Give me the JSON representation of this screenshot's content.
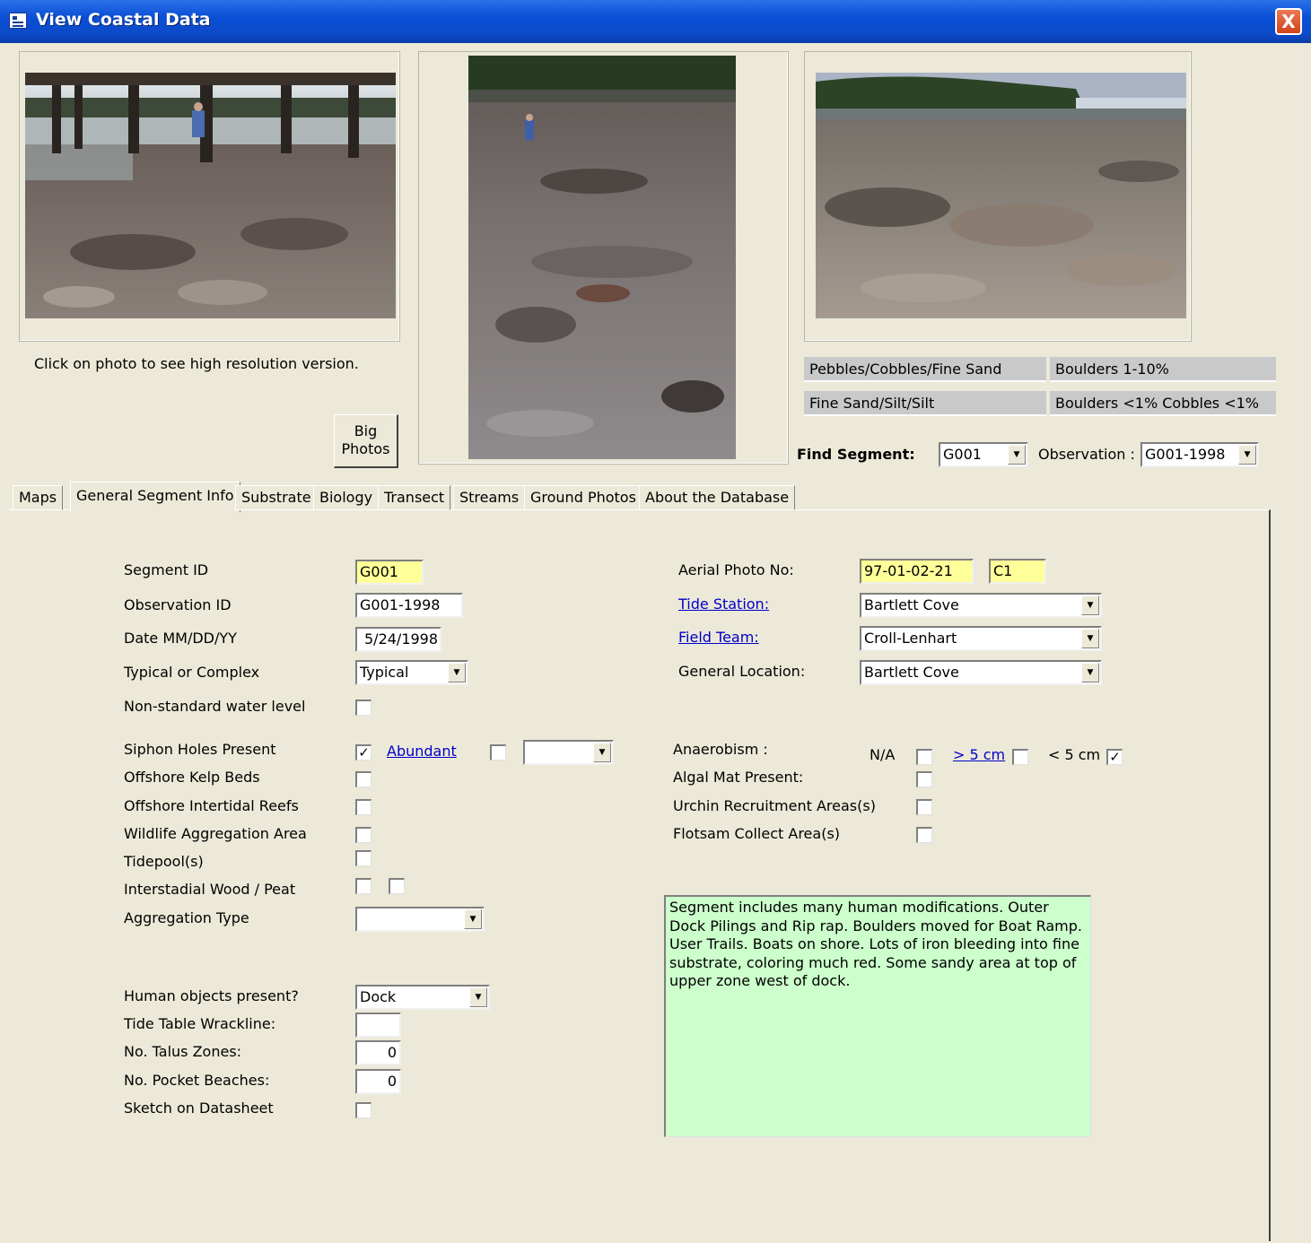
{
  "window": {
    "title": "View Coastal Data",
    "close_label": "X"
  },
  "photos": {
    "hint": "Click on photo to see high resolution version.",
    "big_photos_label_1": "Big",
    "big_photos_label_2": "Photos"
  },
  "substrate": {
    "row1_primary": "Pebbles/Cobbles/Fine Sand",
    "row1_secondary": "Boulders 1-10%",
    "row2_primary": "Fine Sand/Silt/Silt",
    "row2_secondary": "Boulders <1%  Cobbles  <1%"
  },
  "find": {
    "segment_label": "Find Segment:",
    "segment_value": "G001",
    "observation_label": "Observation :",
    "observation_value": "G001-1998"
  },
  "tabs": [
    {
      "label": "Maps"
    },
    {
      "label": "General Segment Info"
    },
    {
      "label": "Substrate"
    },
    {
      "label": "Biology"
    },
    {
      "label": "Transect"
    },
    {
      "label": "Streams"
    },
    {
      "label": "Ground Photos"
    },
    {
      "label": "About the Database"
    }
  ],
  "form": {
    "segment_id": {
      "label": "Segment ID",
      "value": "G001"
    },
    "observation_id": {
      "label": "Observation ID",
      "value": "G001-1998"
    },
    "date": {
      "label": "Date MM/DD/YY",
      "value": "5/24/1998"
    },
    "typical": {
      "label": "Typical or Complex",
      "value": "Typical"
    },
    "nonstandard": {
      "label": "Non-standard water level"
    },
    "siphon": {
      "label": "Siphon Holes Present",
      "link": "Abundant",
      "combo_value": ""
    },
    "kelp": {
      "label": "Offshore Kelp Beds"
    },
    "reefs": {
      "label": "Offshore Intertidal Reefs"
    },
    "wildlife": {
      "label": "Wildlife Aggregation Area"
    },
    "tidepools": {
      "label": "Tidepool(s)"
    },
    "wood": {
      "label": "Interstadial Wood / Peat"
    },
    "aggregation": {
      "label": "Aggregation Type",
      "value": ""
    },
    "human": {
      "label": "Human objects present?",
      "value": "Dock"
    },
    "wrackline": {
      "label": "Tide Table Wrackline:",
      "value": ""
    },
    "talus": {
      "label": "No. Talus Zones:",
      "value": "0"
    },
    "pocket": {
      "label": "No. Pocket Beaches:",
      "value": "0"
    },
    "sketch": {
      "label": "Sketch on Datasheet"
    },
    "aerial": {
      "label": "Aerial Photo No:",
      "value": "97-01-02-21",
      "value2": "C1"
    },
    "tide_station": {
      "label": "Tide Station:",
      "value": "Bartlett Cove"
    },
    "field_team": {
      "label": "Field Team:",
      "value": "Croll-Lenhart"
    },
    "location": {
      "label": "General Location:",
      "value": "Bartlett Cove"
    },
    "anaerobism": {
      "label": "Anaerobism :",
      "na": "N/A",
      "gt5": "> 5 cm",
      "lt5": "< 5 cm"
    },
    "algal": {
      "label": "Algal Mat Present:"
    },
    "urchin": {
      "label": "Urchin Recruitment Areas(s)"
    },
    "flotsam": {
      "label": "Flotsam Collect Area(s)"
    },
    "notes": "Segment includes many human modifications.  Outer Dock Pilings and Rip rap.  Boulders moved for Boat Ramp.  User Trails.  Boats on shore.  Lots of iron bleeding into fine substrate, coloring much red.  Some sandy area at top of upper zone west of dock."
  },
  "checked_mark": "✓",
  "dropdown_glyph": "▼"
}
